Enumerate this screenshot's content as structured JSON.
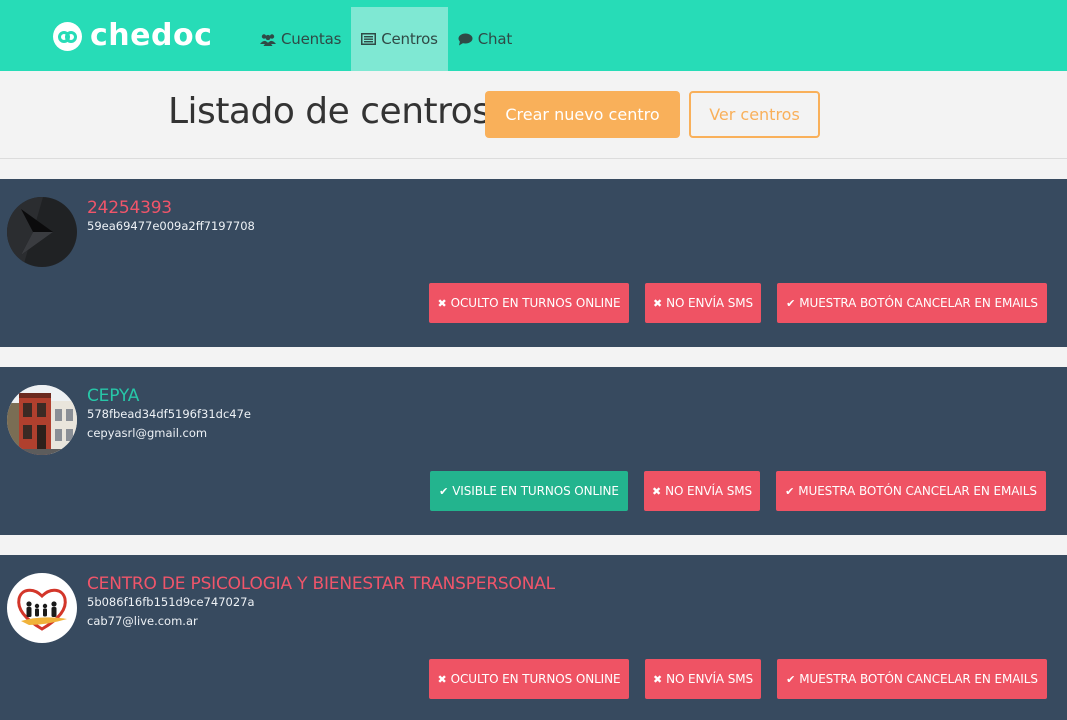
{
  "brand": {
    "name": "chedoc"
  },
  "nav": [
    {
      "label": "Cuentas",
      "icon": "users-icon"
    },
    {
      "label": "Centros",
      "icon": "list-icon",
      "active": true
    },
    {
      "label": "Chat",
      "icon": "comment-icon"
    }
  ],
  "heading": {
    "title": "Listado de centros",
    "create_label": "Crear nuevo centro",
    "view_label": "Ver centros"
  },
  "colors": {
    "topbar": "#27dcb7",
    "nav_active": "#7fe8d3",
    "accent_orange": "#f9b05a",
    "card_bg": "#374a5f",
    "danger": "#ef5364",
    "success": "#23b48e"
  },
  "centers": [
    {
      "name": "24254393",
      "name_color": "#f0556a",
      "id": "59ea69477e009a2ff7197708",
      "email": "",
      "avatar": "dark-arrow-logo",
      "flags": [
        {
          "label": "OCULTO EN TURNOS ONLINE",
          "icon": "times-icon",
          "status": "danger"
        },
        {
          "label": "NO ENVÍA SMS",
          "icon": "times-icon",
          "status": "danger"
        },
        {
          "label": "MUESTRA BOTÓN CANCELAR EN EMAILS",
          "icon": "check-icon",
          "status": "danger"
        }
      ]
    },
    {
      "name": "CEPYA",
      "name_color": "#27c7a8",
      "id": "578fbead34df5196f31dc47e",
      "email": "cepyasrl@gmail.com",
      "avatar": "building-photo",
      "flags": [
        {
          "label": "VISIBLE EN TURNOS ONLINE",
          "icon": "check-icon",
          "status": "success"
        },
        {
          "label": "NO ENVÍA SMS",
          "icon": "times-icon",
          "status": "danger"
        },
        {
          "label": "MUESTRA BOTÓN CANCELAR EN EMAILS",
          "icon": "check-icon",
          "status": "danger"
        }
      ]
    },
    {
      "name": "CENTRO DE PSICOLOGIA Y BIENESTAR TRANSPERSONAL",
      "name_color": "#f0556a",
      "id": "5b086f16fb151d9ce747027a",
      "email": "cab77@live.com.ar",
      "avatar": "family-heart-logo",
      "flags": [
        {
          "label": "OCULTO EN TURNOS ONLINE",
          "icon": "times-icon",
          "status": "danger"
        },
        {
          "label": "NO ENVÍA SMS",
          "icon": "times-icon",
          "status": "danger"
        },
        {
          "label": "MUESTRA BOTÓN CANCELAR EN EMAILS",
          "icon": "check-icon",
          "status": "danger"
        }
      ]
    }
  ]
}
